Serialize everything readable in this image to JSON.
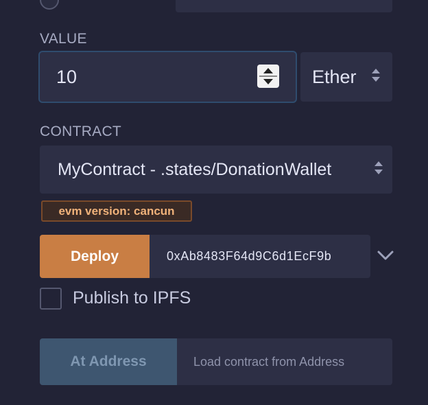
{
  "value_section": {
    "label": "VALUE",
    "amount": "10",
    "unit": "Ether"
  },
  "contract_section": {
    "label": "CONTRACT",
    "selected": "MyContract - .states/DonationWallet",
    "evm_badge": "evm version: cancun"
  },
  "deploy": {
    "button_label": "Deploy",
    "address": "0xAb8483F64d9C6d1EcF9b"
  },
  "ipfs": {
    "label": "Publish to IPFS",
    "checked": false
  },
  "at_address": {
    "button_label": "At Address",
    "placeholder": "Load contract from Address"
  },
  "colors": {
    "background": "#222336",
    "field": "#2d2f45",
    "deploy_accent": "#c97e44",
    "badge_text": "#f0b27a",
    "at_address_button": "#3e5670"
  },
  "icons": {
    "stepper": "up-down-stepper-icon",
    "select": "select-arrows-icon",
    "expand": "chevron-down-icon"
  }
}
